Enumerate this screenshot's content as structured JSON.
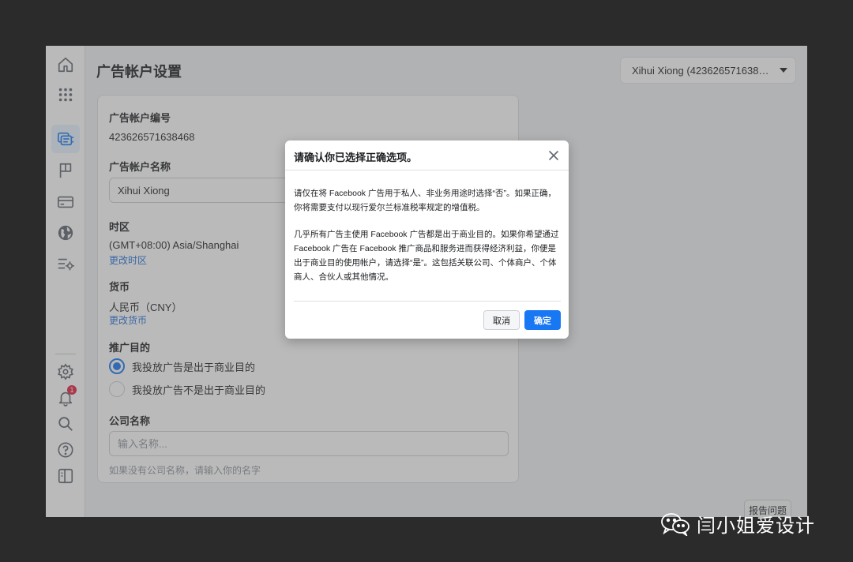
{
  "page": {
    "title": "广告帐户设置"
  },
  "account_selector": {
    "value": "Xihui Xiong (42362657163846..."
  },
  "nav": {
    "items": [
      {
        "name": "home-icon"
      },
      {
        "name": "apps-grid-icon"
      },
      {
        "name": "ad-accounts-icon",
        "active": true
      },
      {
        "name": "flag-icon"
      },
      {
        "name": "billing-card-icon"
      },
      {
        "name": "globe-icon"
      },
      {
        "name": "settings-list-icon"
      }
    ],
    "bottom_items": [
      {
        "name": "gear-icon"
      },
      {
        "name": "bell-icon",
        "badge": "1"
      },
      {
        "name": "search-icon"
      },
      {
        "name": "help-icon"
      },
      {
        "name": "panel-toggle-icon"
      }
    ]
  },
  "form": {
    "account_id_label": "广告帐户编号",
    "account_id": "423626571638468",
    "account_name_label": "广告帐户名称",
    "account_name_value": "Xihui Xiong",
    "timezone_label": "时区",
    "timezone_value": "(GMT+08:00) Asia/Shanghai",
    "timezone_change": "更改时区",
    "currency_label": "货币",
    "currency_value": "人民币（CNY）",
    "currency_change": "更改货币",
    "purpose_label": "推广目的",
    "purpose_options": [
      {
        "label": "我投放广告是出于商业目的",
        "checked": true
      },
      {
        "label": "我投放广告不是出于商业目的",
        "checked": false
      }
    ],
    "company_label": "公司名称",
    "company_placeholder": "输入名称...",
    "company_hint": "如果没有公司名称，请输入你的名字"
  },
  "report_button": "报告问题",
  "modal": {
    "title": "请确认你已选择正确选项。",
    "paragraph1": "请仅在将 Facebook 广告用于私人、非业务用途时选择“否”。如果正确，你将需要支付以现行爱尔兰标准税率规定的增值税。",
    "paragraph2": "几乎所有广告主使用 Facebook 广告都是出于商业目的。如果你希望通过 Facebook 广告在 Facebook 推广商品和服务进而获得经济利益，你便是出于商业目的使用帐户，请选择“是”。这包括关联公司、个体商户、个体商人、合伙人或其他情况。",
    "cancel": "取消",
    "confirm": "确定"
  },
  "watermark": {
    "text": "闫小姐爱设计"
  },
  "colors": {
    "primary": "#1877f2",
    "link": "#216fdb",
    "badge": "#e41e3f",
    "background": "#f0f2f5"
  }
}
